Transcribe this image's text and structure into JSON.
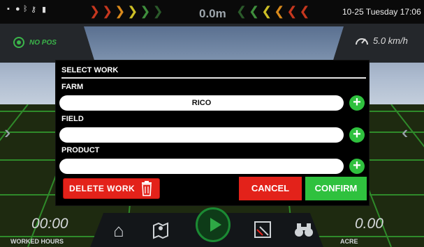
{
  "status_bar": {
    "distance": "0.0m",
    "datetime": "10-25 Tuesday 17:06",
    "icons": [
      "notification-icon",
      "location-icon",
      "bluetooth-icon",
      "key-icon",
      "battery-icon"
    ],
    "left_arrows_colors": [
      "#c6371e",
      "#c6371e",
      "#d98a1c",
      "#cdbf26",
      "#3f8e3c",
      "#2b5a2a"
    ],
    "right_arrows_colors": [
      "#2b5a2a",
      "#3f8e3c",
      "#cdbf26",
      "#d98a1c",
      "#c6371e",
      "#c6371e"
    ]
  },
  "gps": {
    "status": "NO POS",
    "color": "#3bb54a"
  },
  "speed": {
    "value": "5.0 km/h"
  },
  "bottom": {
    "worked_hours_value": "00:00",
    "worked_hours_label": "WORKED HOURS",
    "acre_value": "0.00",
    "acre_label": "ACRE",
    "dock_icons": [
      "home-icon",
      "map-icon",
      "play-icon",
      "field-boundary-icon",
      "binoculars-icon"
    ]
  },
  "dialog": {
    "title": "SELECT WORK",
    "farm_label": "FARM",
    "farm_value": "RICO",
    "field_label": "FIELD",
    "field_value": "",
    "product_label": "PRODUCT",
    "product_value": "",
    "delete_label": "DELETE WORK",
    "cancel_label": "CANCEL",
    "confirm_label": "CONFIRM",
    "colors": {
      "danger": "#e3221a",
      "success": "#2fc13e"
    }
  }
}
